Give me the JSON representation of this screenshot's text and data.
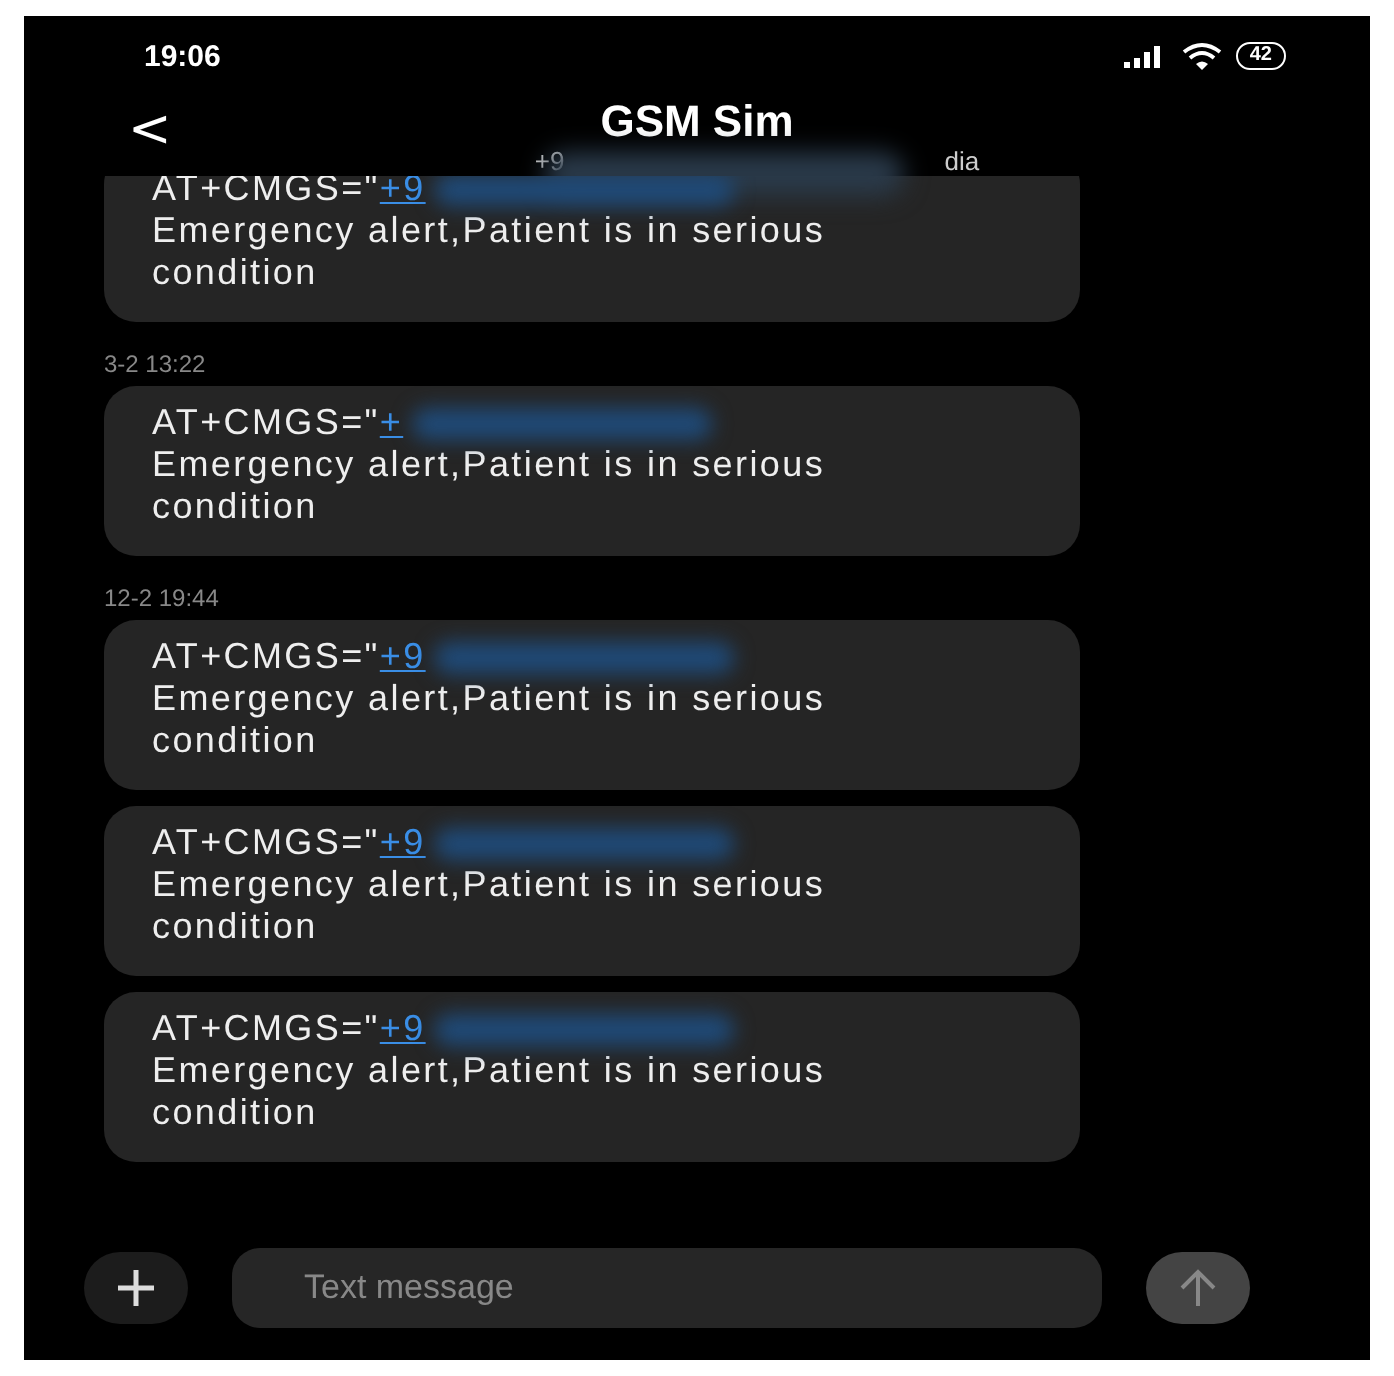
{
  "status_bar": {
    "time": "19:06",
    "battery": "42"
  },
  "header": {
    "back": "<",
    "title": "GSM Sim",
    "subtitle_start": "+9",
    "subtitle_end": "dia"
  },
  "conversation": [
    {
      "kind": "message",
      "command": "AT+CMGS=\"",
      "number": "+9",
      "text": "Emergency alert,Patient is in serious condition"
    },
    {
      "kind": "timestamp",
      "text": "3-2 13:22"
    },
    {
      "kind": "message",
      "command": "AT+CMGS=\"",
      "number": "+",
      "text": "Emergency alert,Patient is in serious condition"
    },
    {
      "kind": "timestamp",
      "text": "12-2 19:44"
    },
    {
      "kind": "message",
      "command": "AT+CMGS=\"",
      "number": "+9",
      "text": "Emergency alert,Patient is in serious condition"
    },
    {
      "kind": "message",
      "command": "AT+CMGS=\"",
      "number": "+9",
      "text": "Emergency alert,Patient is in serious condition"
    },
    {
      "kind": "message",
      "command": "AT+CMGS=\"",
      "number": "+9",
      "text": "Emergency alert,Patient is in serious condition"
    }
  ],
  "composer": {
    "placeholder": "Text message"
  }
}
